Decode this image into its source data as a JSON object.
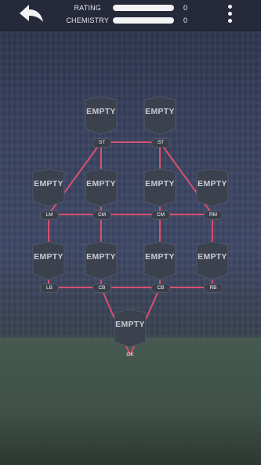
{
  "header": {
    "rating_label": "RATING",
    "rating_value": "0",
    "chemistry_label": "CHEMISTRY",
    "chemistry_value": "0",
    "rating_fill": 1.0,
    "chemistry_fill": 1.0
  },
  "icons": {
    "back": "back-arrow-icon",
    "menu": "more-vertical-icon"
  },
  "colors": {
    "link": "#d8506e",
    "card": "#3c414e",
    "topbar": "#25293a"
  },
  "formation": {
    "empty_label": "EMPTY",
    "slots": [
      {
        "position": "ST"
      },
      {
        "position": "ST"
      },
      {
        "position": "LM"
      },
      {
        "position": "CM"
      },
      {
        "position": "CM"
      },
      {
        "position": "RM"
      },
      {
        "position": "LB"
      },
      {
        "position": "CB"
      },
      {
        "position": "CB"
      },
      {
        "position": "RB"
      },
      {
        "position": "GK"
      }
    ]
  }
}
